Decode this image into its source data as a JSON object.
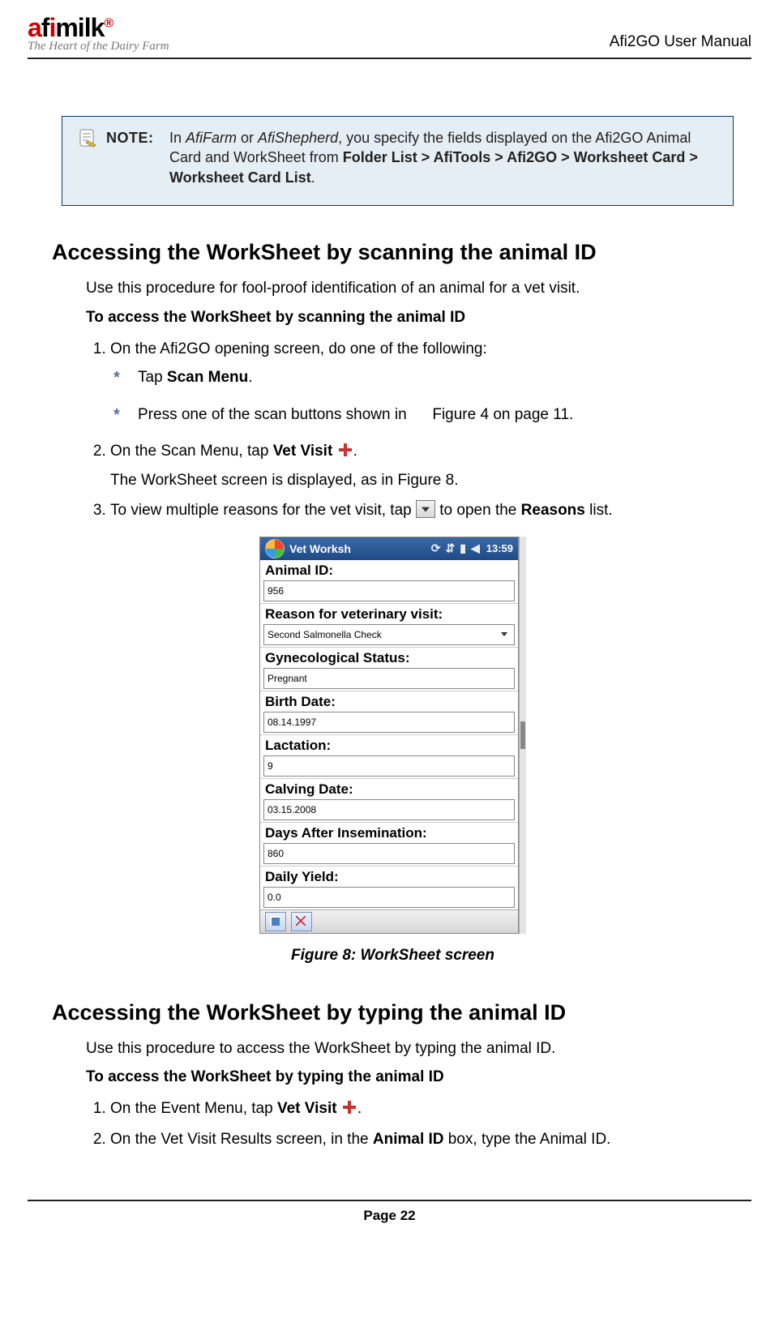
{
  "header": {
    "logo_main": "afimilk",
    "logo_tag": "The Heart of the Dairy Farm",
    "doc_title": "Afi2GO User Manual"
  },
  "note": {
    "label": "NOTE:",
    "t1": "In ",
    "em1": "AfiFarm",
    "t2": " or ",
    "em2": "AfiShepherd",
    "t3": ", you specify the fields displayed on the Afi2GO Animal Card and WorkSheet from ",
    "path": "Folder List > AfiTools > Afi2GO > Worksheet Card > Worksheet Card List",
    "t4": "."
  },
  "sec1": {
    "heading": "Accessing the WorkSheet by scanning the animal ID",
    "intro": "Use this procedure for fool-proof identification of an animal for a vet visit.",
    "howto": "To access the WorkSheet by scanning the animal ID",
    "s1": "On the Afi2GO opening screen, do one of the following:",
    "star1a": "Tap ",
    "star1b": "Scan Menu",
    "star1c": ".",
    "star2a": "Press one of the scan buttons shown in ",
    "star2b": "Figure 4 on page 11.",
    "s2a": "On the Scan Menu, tap ",
    "s2b": "Vet Visit",
    "s2c": ".",
    "s2d": "The WorkSheet screen is displayed, as in Figure 8.",
    "s3a": "To view multiple reasons for the vet visit, tap ",
    "s3b": " to open the ",
    "s3c": "Reasons",
    "s3d": " list."
  },
  "device": {
    "title": "Vet Worksh",
    "clock": "13:59",
    "fields": [
      {
        "label": "Animal ID:",
        "value": "956",
        "dropdown": false
      },
      {
        "label": "Reason for veterinary visit:",
        "value": "Second Salmonella Check",
        "dropdown": true
      },
      {
        "label": "Gynecological Status:",
        "value": "Pregnant",
        "dropdown": false
      },
      {
        "label": "Birth Date:",
        "value": "08.14.1997",
        "dropdown": false
      },
      {
        "label": "Lactation:",
        "value": "9",
        "dropdown": false
      },
      {
        "label": "Calving Date:",
        "value": "03.15.2008",
        "dropdown": false
      },
      {
        "label": "Days After Insemination:",
        "value": "860",
        "dropdown": false
      },
      {
        "label": "Daily Yield:",
        "value": "0.0",
        "dropdown": false
      }
    ]
  },
  "fig_caption": "Figure 8: WorkSheet screen",
  "sec2": {
    "heading": "Accessing the WorkSheet by typing the animal ID",
    "intro": "Use this procedure to access the WorkSheet by typing the animal ID.",
    "howto": "To access the WorkSheet by typing the animal ID",
    "s1a": "On the Event Menu, tap ",
    "s1b": "Vet Visit",
    "s1c": ".",
    "s2a": "On the Vet Visit Results screen, in the ",
    "s2b": "Animal ID",
    "s2c": " box, type the Animal ID."
  },
  "footer": "Page 22"
}
